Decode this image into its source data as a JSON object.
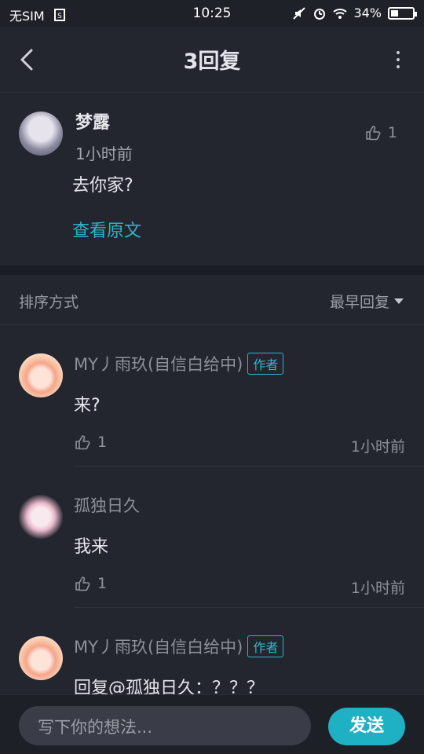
{
  "status_bar": {
    "carrier": "无SIM",
    "time": "10:25",
    "battery": "34%",
    "battery_level": 0.34,
    "icons": [
      "sim-icon",
      "mute-icon",
      "alarm-icon",
      "wifi-icon",
      "battery-icon"
    ]
  },
  "header": {
    "title": "3回复"
  },
  "original_post": {
    "author": "梦露",
    "time": "1小时前",
    "content": "去你家?",
    "view_original": "查看原文",
    "likes": "1"
  },
  "sort": {
    "label": "排序方式",
    "selected": "最早回复"
  },
  "replies": [
    {
      "author": "MY丿雨玖(自信白给中)",
      "badge": "作者",
      "text": "来?",
      "likes": "1",
      "time": "1小时前"
    },
    {
      "author": "孤独日久",
      "badge": "",
      "text": "我来",
      "likes": "1",
      "time": "1小时前"
    },
    {
      "author": "MY丿雨玖(自信白给中)",
      "badge": "作者",
      "text": "回复@孤独日久：？？？",
      "likes": "",
      "time": ""
    }
  ],
  "composer": {
    "placeholder": "写下你的想法...",
    "send_label": "发送"
  },
  "colors": {
    "background": "#23252f",
    "accent": "#20b0c4",
    "link": "#29b6c9"
  }
}
